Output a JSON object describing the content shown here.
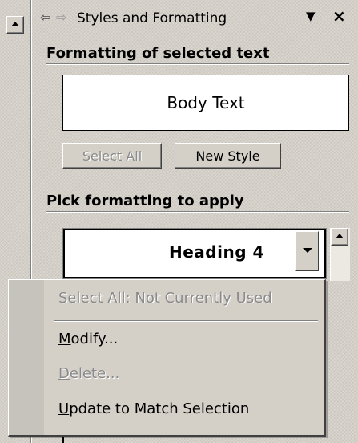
{
  "pane": {
    "title": "Styles and Formatting",
    "back_icon": "back-arrow-icon",
    "forward_icon": "forward-arrow-icon",
    "menu_icon": "▼",
    "close_icon": "×"
  },
  "formatting_selected": {
    "heading": "Formatting of selected text",
    "current_style": "Body Text",
    "select_all_label": "Select All",
    "new_style_label": "New Style"
  },
  "pick_formatting": {
    "heading": "Pick formatting to apply",
    "selected_item": "Heading 4"
  },
  "context_menu": {
    "items": [
      {
        "pre": "",
        "u": "",
        "post": "Select All: Not Currently Used",
        "enabled": false
      },
      {
        "pre": "",
        "u": "M",
        "post": "odify...",
        "enabled": true
      },
      {
        "pre": "",
        "u": "D",
        "post": "elete...",
        "enabled": false
      },
      {
        "pre": "",
        "u": "U",
        "post": "pdate to Match Selection",
        "enabled": true
      }
    ]
  },
  "colors": {
    "face": "#d4d0c8",
    "disabled_text": "#8a8a8a"
  }
}
